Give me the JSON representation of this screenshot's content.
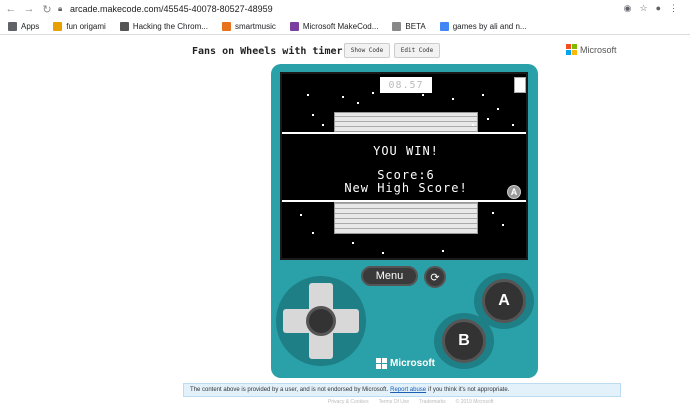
{
  "browser": {
    "back_icon": "back-arrow-icon",
    "forward_icon": "forward-arrow-icon",
    "reload_icon": "reload-icon",
    "url": "arcade.makecode.com/45545-40078-80527-48959"
  },
  "bookmarks": [
    {
      "label": "Apps",
      "icon": "apps-grid-icon",
      "color": "#5f6368"
    },
    {
      "label": "fun origami",
      "icon": "origami-icon",
      "color": "#e8a000"
    },
    {
      "label": "Hacking the Chrom...",
      "icon": "ms-icon",
      "color": "#555555"
    },
    {
      "label": "smartmusic",
      "icon": "smartmusic-icon",
      "color": "#e8711b"
    },
    {
      "label": "Microsoft MakeCod...",
      "icon": "makecode-icon",
      "color": "#7b3fa0"
    },
    {
      "label": "BETA",
      "icon": "beta-icon",
      "color": "#888888"
    },
    {
      "label": "games by ali and n...",
      "icon": "docs-icon",
      "color": "#4285f4"
    }
  ],
  "header": {
    "title": "Fans on Wheels with timer",
    "show_code": "Show Code",
    "edit_code": "Edit Code",
    "brand": "Microsoft"
  },
  "game": {
    "timer": "08.57",
    "line1": "YOU WIN!",
    "line2": "Score:6",
    "line3": "New High Score!",
    "a_prompt": "A"
  },
  "controls": {
    "menu": "Menu",
    "a": "A",
    "b": "B",
    "brand": "Microsoft"
  },
  "notice": {
    "text1": "The content above is provided by a user, and is not endorsed by Microsoft.",
    "link": "Report abuse",
    "text2": "if you think it's not appropriate."
  },
  "footer": [
    "Privacy & Cookies",
    "Terms Of Use",
    "Trademarks",
    "© 2019 Microsoft"
  ],
  "colors": {
    "console": "#2aa1a8",
    "ms_red": "#f25022",
    "ms_green": "#7fba00",
    "ms_blue": "#00a4ef",
    "ms_yellow": "#ffb900"
  }
}
